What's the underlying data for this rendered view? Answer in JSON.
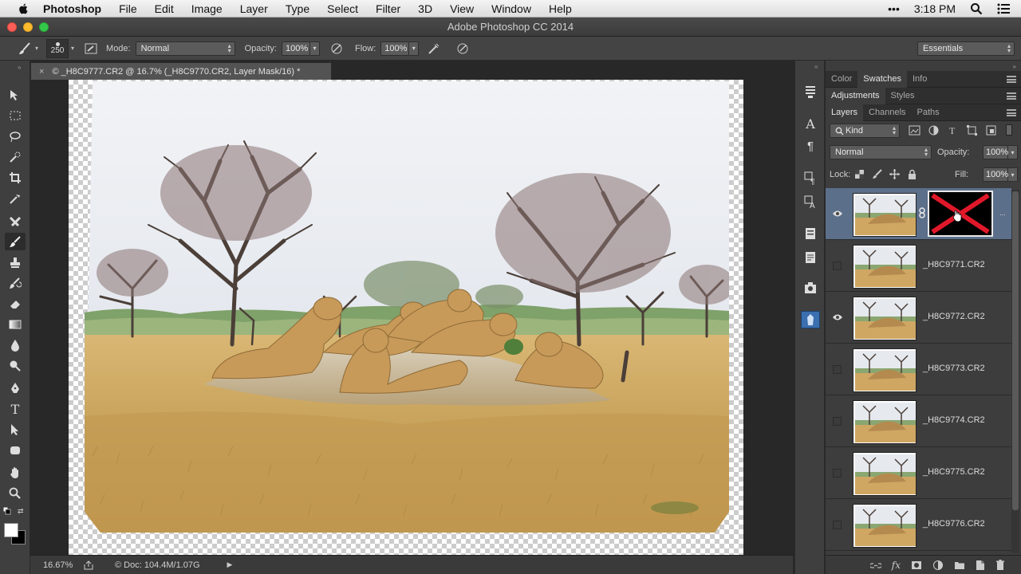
{
  "menubar": {
    "app_name": "Photoshop",
    "items": [
      "File",
      "Edit",
      "Image",
      "Layer",
      "Type",
      "Select",
      "Filter",
      "3D",
      "View",
      "Window",
      "Help"
    ],
    "dots": "•••",
    "time": "3:18 PM"
  },
  "window": {
    "title": "Adobe Photoshop CC 2014"
  },
  "options": {
    "brush_size": "250",
    "mode_label": "Mode:",
    "mode_value": "Normal",
    "opacity_label": "Opacity:",
    "opacity_value": "100%",
    "flow_label": "Flow:",
    "flow_value": "100%",
    "workspace": "Essentials"
  },
  "document": {
    "tab_title": "© _H8C9777.CR2 @ 16.7% (_H8C9770.CR2, Layer Mask/16) *",
    "close_label": "×"
  },
  "statusbar": {
    "zoom": "16.67%",
    "doc_info": "© Doc: 104.4M/1.07G"
  },
  "panels": {
    "group1_tabs": [
      "Color",
      "Swatches",
      "Info"
    ],
    "group1_active": "Swatches",
    "group2_tabs": [
      "Adjustments",
      "Styles"
    ],
    "group2_active": "Adjustments",
    "group3_tabs": [
      "Layers",
      "Channels",
      "Paths"
    ],
    "group3_active": "Layers",
    "filter_kind": "Kind",
    "blend_mode": "Normal",
    "opacity_label": "Opacity:",
    "opacity_value": "100%",
    "lock_label": "Lock:",
    "fill_label": "Fill:",
    "fill_value": "100%"
  },
  "layers": [
    {
      "name": "",
      "visible": true,
      "selected": true,
      "has_mask": true
    },
    {
      "name": "_H8C9771.CR2",
      "visible": false
    },
    {
      "name": "_H8C9772.CR2",
      "visible": true
    },
    {
      "name": "_H8C9773.CR2",
      "visible": false
    },
    {
      "name": "_H8C9774.CR2",
      "visible": false
    },
    {
      "name": "_H8C9775.CR2",
      "visible": false
    },
    {
      "name": "_H8C9776.CR2",
      "visible": false
    }
  ],
  "colors": {
    "accent_selected": "#5c6f8a",
    "mask_cross": "#e0182a",
    "foreground_swatch": "#ffffff",
    "background_swatch": "#000000"
  },
  "icons": {
    "tools": [
      "move-icon",
      "marquee-icon",
      "lasso-icon",
      "quick-select-icon",
      "crop-icon",
      "eyedropper-icon",
      "healing-icon",
      "brush-icon",
      "stamp-icon",
      "history-brush-icon",
      "eraser-icon",
      "gradient-icon",
      "blur-icon",
      "dodge-icon",
      "pen-icon",
      "type-icon",
      "path-select-icon",
      "shape-icon",
      "hand-icon",
      "zoom-icon"
    ]
  }
}
